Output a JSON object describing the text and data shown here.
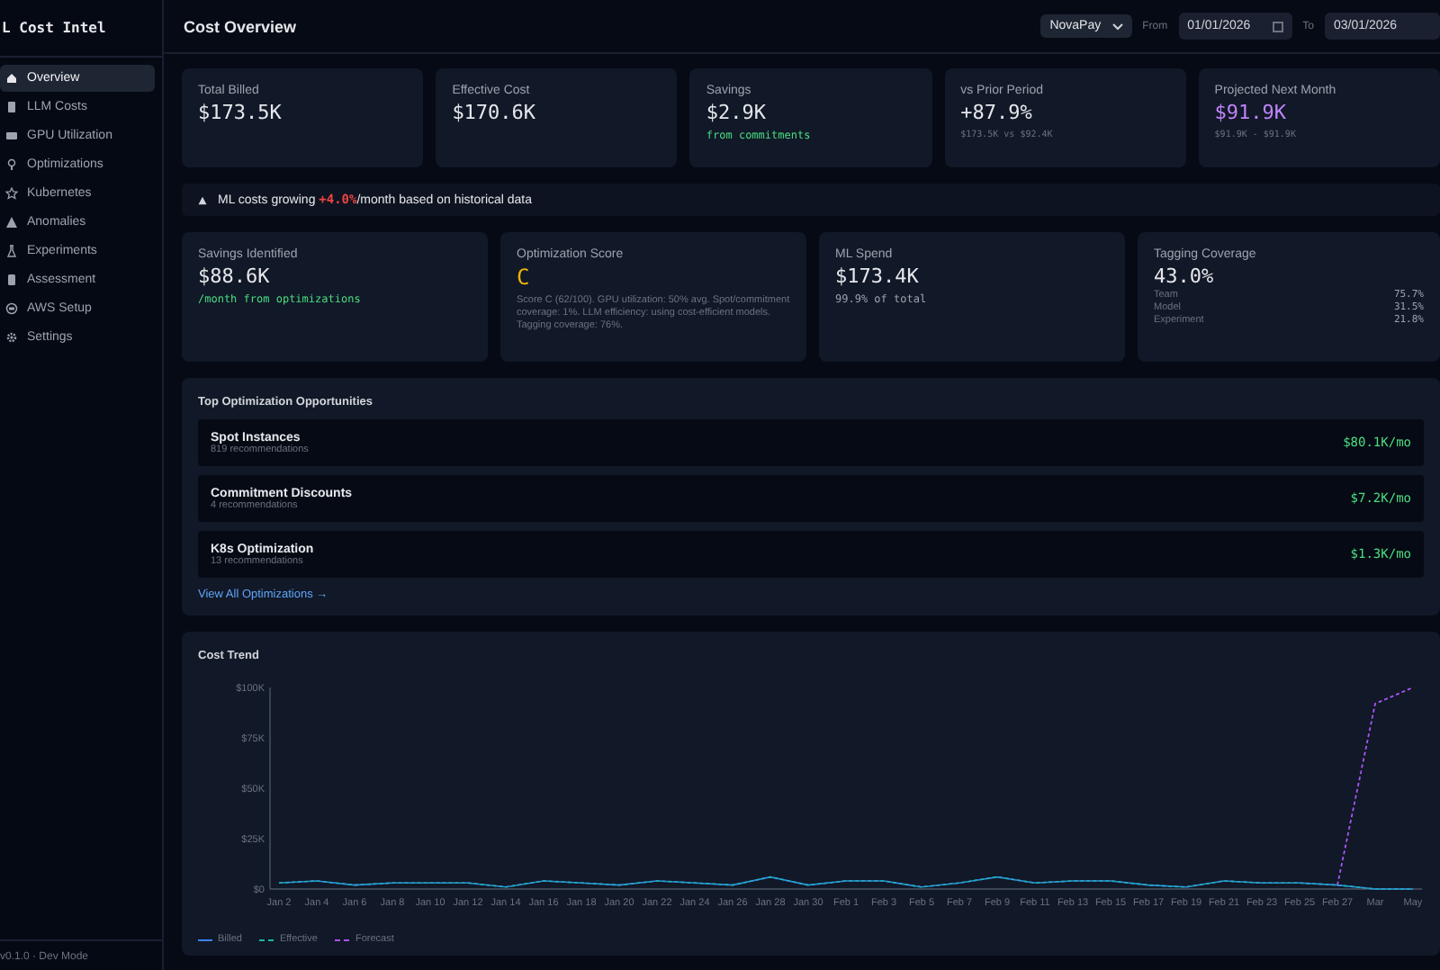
{
  "sidebar": {
    "logo": "L Cost Intel",
    "items": [
      {
        "label": "Overview",
        "selected": true
      },
      {
        "label": "LLM Costs",
        "selected": false
      },
      {
        "label": "GPU Utilization",
        "selected": false
      },
      {
        "label": "Optimizations",
        "selected": false
      },
      {
        "label": "Kubernetes",
        "selected": false
      },
      {
        "label": "Anomalies",
        "selected": false
      },
      {
        "label": "Experiments",
        "selected": false
      },
      {
        "label": "Assessment",
        "selected": false
      },
      {
        "label": "AWS Setup",
        "selected": false
      },
      {
        "label": "Settings",
        "selected": false
      }
    ],
    "version": "v0.1.0 · Dev Mode"
  },
  "header": {
    "title": "Cost Overview",
    "account": "NovaPay",
    "from_label": "From",
    "from_date": "01/01/2026",
    "to_label": "To",
    "to_date": "03/01/2026"
  },
  "stats": [
    {
      "label": "Total Billed",
      "value": "$173.5K"
    },
    {
      "label": "Effective Cost",
      "value": "$170.6K"
    },
    {
      "label": "Savings",
      "value": "$2.9K",
      "note": "from commitments",
      "kind": "positive"
    },
    {
      "label": "vs Prior Period",
      "value": "+87.9%",
      "note": "$173.5K vs $92.4K",
      "kind": "muted"
    },
    {
      "label": "Projected Next Month",
      "value": "$91.9K",
      "note": "$91.9K - $91.9K",
      "kind": "forecast"
    }
  ],
  "alert": {
    "text": "ML costs growing **+4.0%**/month based on historical data"
  },
  "summary": [
    {
      "label": "Savings Identified",
      "value": "$88.6K",
      "note": "/month from optimizations",
      "kind": "positive"
    },
    {
      "label": "Optimization Score",
      "value": "C",
      "note": "Score C (62/100). GPU utilization: 50% avg. Spot/commitment coverage: 1%. LLM efficiency: using cost-efficient models. Tagging coverage: 76%.",
      "kind": "grade"
    },
    {
      "label": "ML Spend",
      "value": "$173.4K",
      "note": "99.9% of total",
      "kind": "plain"
    },
    {
      "label": "Tagging Coverage",
      "value": "43.0%",
      "kind": "breakdown",
      "rows": [
        {
          "name": "Team",
          "value": "75.7%"
        },
        {
          "name": "Model",
          "value": "31.5%"
        },
        {
          "name": "Experiment",
          "value": "21.8%"
        }
      ]
    }
  ],
  "opportunities": {
    "title": "Top Optimization Opportunities",
    "items": [
      {
        "name": "Spot Instances",
        "count": "819 recommendations",
        "amount": "$80.1K/mo"
      },
      {
        "name": "Commitment Discounts",
        "count": "4 recommendations",
        "amount": "$7.2K/mo"
      },
      {
        "name": "K8s Optimization",
        "count": "13 recommendations",
        "amount": "$1.3K/mo"
      }
    ],
    "link": "View All Optimizations →"
  },
  "trend": {
    "title": "Cost Trend",
    "chart_data": {
      "type": "line",
      "categories": [
        "Jan 2",
        "Jan 4",
        "Jan 6",
        "Jan 8",
        "Jan 10",
        "Jan 12",
        "Jan 14",
        "Jan 16",
        "Jan 18",
        "Jan 20",
        "Jan 22",
        "Jan 24",
        "Jan 26",
        "Jan 28",
        "Jan 30",
        "Feb 1",
        "Feb 3",
        "Feb 5",
        "Feb 7",
        "Feb 9",
        "Feb 11",
        "Feb 13",
        "Feb 15",
        "Feb 17",
        "Feb 19",
        "Feb 21",
        "Feb 23",
        "Feb 25",
        "Feb 27",
        "Mar",
        "May"
      ],
      "yticks": [
        {
          "value": 0,
          "label": "$0"
        },
        {
          "value": 25000,
          "label": "$25K"
        },
        {
          "value": 50000,
          "label": "$50K"
        },
        {
          "value": 75000,
          "label": "$75K"
        },
        {
          "value": 100000,
          "label": "$100K"
        }
      ],
      "ylim": [
        0,
        100000
      ],
      "series": [
        {
          "name": "Billed",
          "color": "#3b82f6",
          "line_style": "solid",
          "values": [
            3000,
            4000,
            2000,
            3000,
            3000,
            3000,
            1000,
            4000,
            3000,
            2000,
            4000,
            3000,
            2000,
            6000,
            2000,
            4000,
            4000,
            1000,
            3000,
            6000,
            3000,
            4000,
            4000,
            2000,
            1000,
            4000,
            3000,
            3000,
            2000,
            0,
            0
          ]
        },
        {
          "name": "Effective",
          "color": "#14b8a6",
          "line_style": "dashed",
          "values": [
            3000,
            4000,
            2000,
            3000,
            3000,
            3000,
            1000,
            4000,
            3000,
            2000,
            4000,
            3000,
            2000,
            6000,
            2000,
            4000,
            4000,
            1000,
            3000,
            6000,
            3000,
            4000,
            4000,
            2000,
            1000,
            4000,
            3000,
            3000,
            2000,
            0,
            0
          ]
        },
        {
          "name": "Forecast",
          "color": "#a855f7",
          "line_style": "dashed",
          "values": [
            null,
            null,
            null,
            null,
            null,
            null,
            null,
            null,
            null,
            null,
            null,
            null,
            null,
            null,
            null,
            null,
            null,
            null,
            null,
            null,
            null,
            null,
            null,
            null,
            null,
            null,
            null,
            null,
            2000,
            92000,
            100000
          ]
        }
      ]
    }
  }
}
